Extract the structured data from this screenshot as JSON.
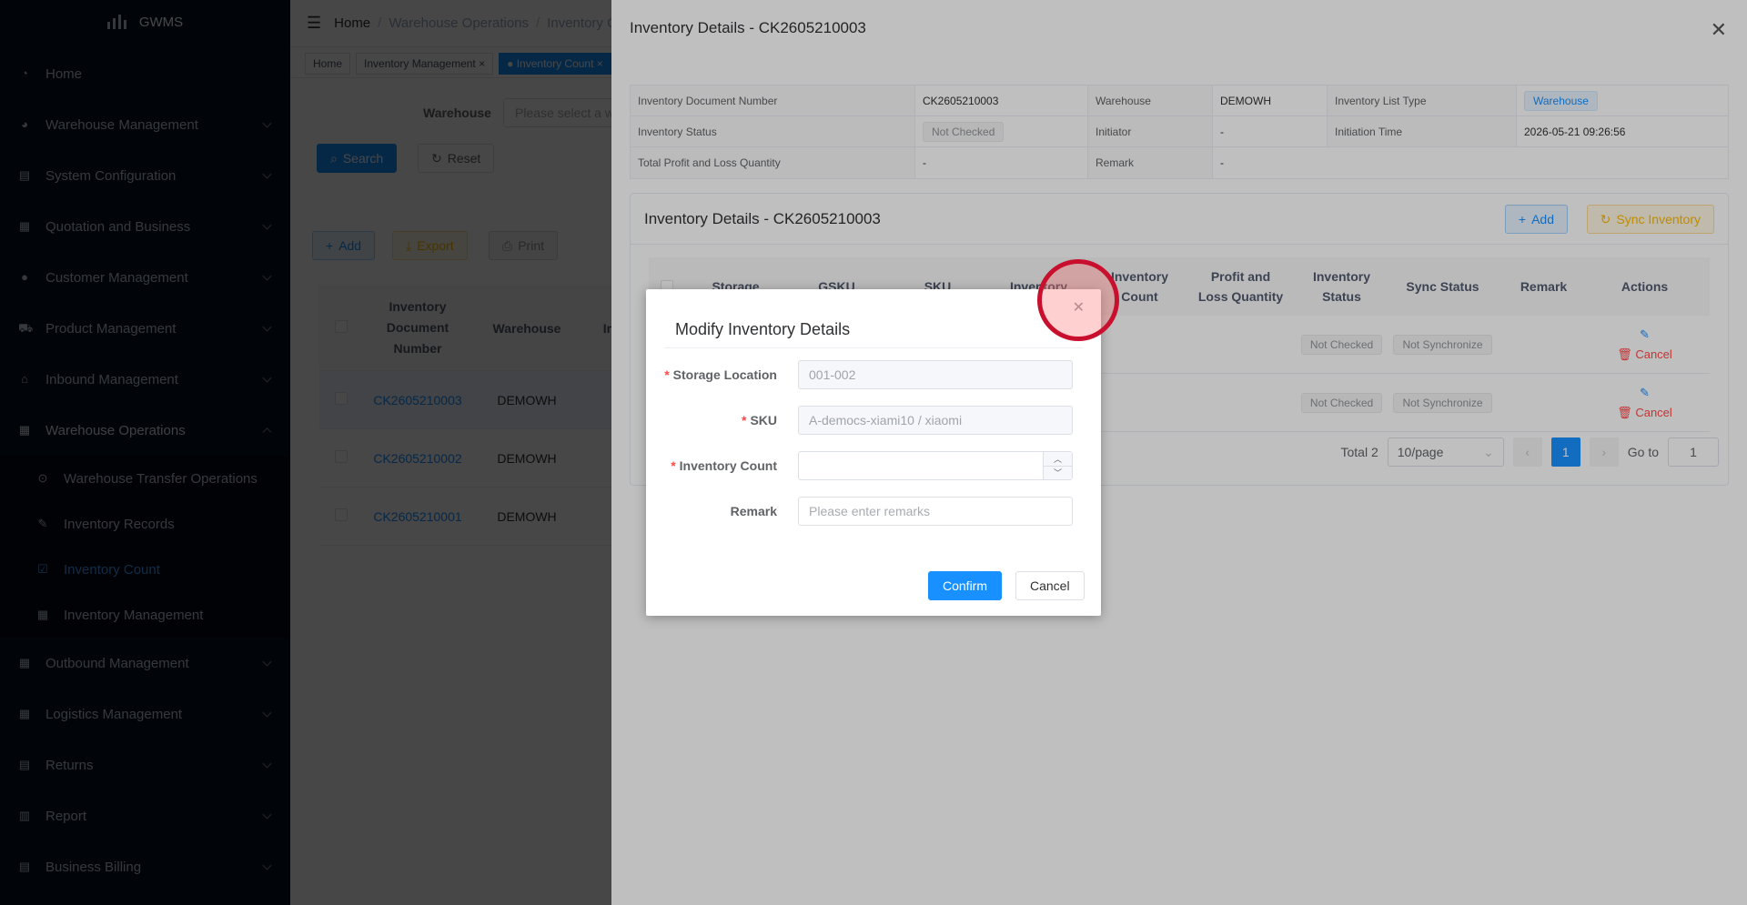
{
  "sidebar": {
    "logo": "GWMS",
    "items": [
      {
        "label": "Home",
        "icon": "dashboard-icon"
      },
      {
        "label": "Warehouse Management",
        "icon": "warehouse-icon"
      },
      {
        "label": "System Configuration",
        "icon": "config-icon"
      },
      {
        "label": "Quotation and Business",
        "icon": "document-icon"
      },
      {
        "label": "Customer Management",
        "icon": "user-icon"
      },
      {
        "label": "Product Management",
        "icon": "cart-icon"
      },
      {
        "label": "Inbound Management",
        "icon": "inbound-icon"
      },
      {
        "label": "Warehouse Operations",
        "icon": "grid-icon"
      }
    ],
    "subitems": [
      {
        "label": "Warehouse Transfer Operations"
      },
      {
        "label": "Inventory Records"
      },
      {
        "label": "Inventory Count"
      },
      {
        "label": "Inventory Management"
      }
    ],
    "items_after": [
      {
        "label": "Outbound Management"
      },
      {
        "label": "Logistics Management"
      },
      {
        "label": "Returns"
      },
      {
        "label": "Report"
      },
      {
        "label": "Business Billing"
      }
    ]
  },
  "main": {
    "breadcrumb": [
      "Home",
      "Warehouse Operations",
      "Inventory C"
    ],
    "tags": [
      "Home",
      "Inventory Management",
      "Inventory Count"
    ],
    "filter_label": "Warehouse",
    "filter_placeholder": "Please select a w",
    "search": "Search",
    "reset": "Reset",
    "add": "Add",
    "export": "Export",
    "print": "Print",
    "columns": [
      "Inventory Document Number",
      "Warehouse",
      "In"
    ],
    "rows": [
      {
        "doc": "CK2605210003",
        "wh": "DEMOWH"
      },
      {
        "doc": "CK2605210002",
        "wh": "DEMOWH"
      },
      {
        "doc": "CK2605210001",
        "wh": "DEMOWH"
      }
    ]
  },
  "drawer": {
    "title": "Inventory Details - CK2605210003",
    "desc": {
      "doc_label": "Inventory Document Number",
      "doc_value": "CK2605210003",
      "wh_label": "Warehouse",
      "wh_value": "DEMOWH",
      "type_label": "Inventory List Type",
      "type_value": "Warehouse",
      "status_label": "Inventory Status",
      "status_value": "Not Checked",
      "init_label": "Initiator",
      "init_value": "-",
      "time_label": "Initiation Time",
      "time_value": "2026-05-21 09:26:56",
      "pl_label": "Total Profit and Loss Quantity",
      "pl_value": "-",
      "remark_label": "Remark",
      "remark_value": "-"
    },
    "card_title": "Inventory Details - CK2605210003",
    "add": "Add",
    "sync": "Sync Inventory",
    "columns": {
      "storage": "Storage",
      "gsku": "GSKU",
      "sku": "SKU",
      "inv": "Inventory",
      "count_1": "Inventory",
      "count_2": "Count",
      "pl_1": "Profit and",
      "pl_2": "Loss Quantity",
      "status_1": "Inventory",
      "status_2": "Status",
      "sync": "Sync Status",
      "remark": "Remark",
      "actions": "Actions"
    },
    "rows": [
      {
        "status": "Not Checked",
        "sync": "Not Synchronize",
        "cancel": "Cancel"
      },
      {
        "status": "Not Checked",
        "sync": "Not Synchronize",
        "cancel": "Cancel"
      }
    ],
    "pager": {
      "total": "Total 2",
      "size": "10/page",
      "page": "1",
      "goto": "Go to",
      "goto_value": "1"
    }
  },
  "modal": {
    "title": "Modify Inventory Details",
    "storage_label": "Storage Location",
    "storage_value": "001-002",
    "sku_label": "SKU",
    "sku_value": "A-democs-xiami10 / xiaomi",
    "count_label": "Inventory Count",
    "count_value": "",
    "remark_label": "Remark",
    "remark_placeholder": "Please enter remarks",
    "confirm": "Confirm",
    "cancel": "Cancel"
  }
}
